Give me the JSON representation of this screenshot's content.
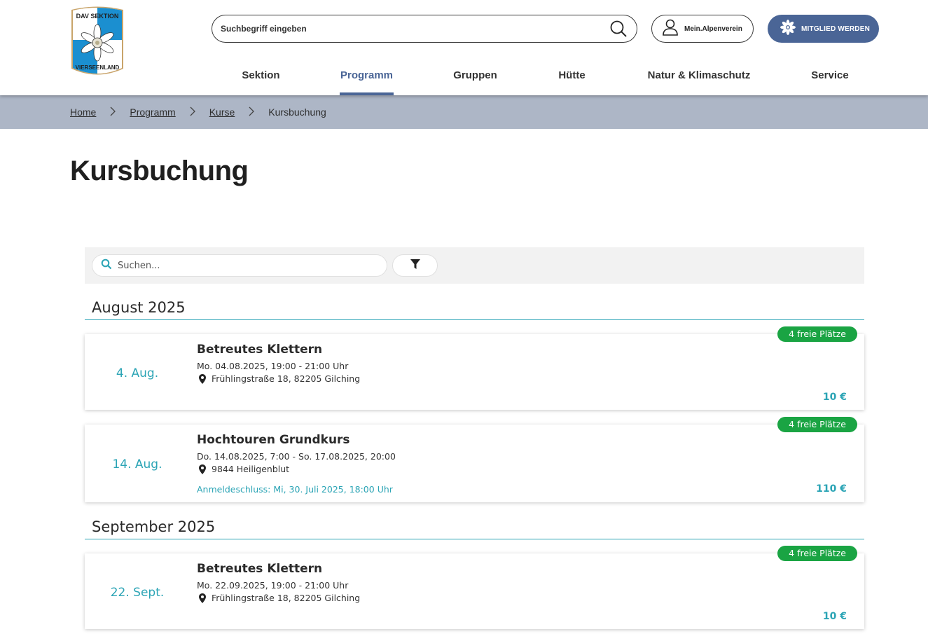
{
  "logo": {
    "top_text": "DAV SEKTION",
    "bottom_text": "VIERSEENLAND",
    "colors": {
      "blue": "#1b8fd0",
      "white": "#ffffff",
      "gold": "#c9a46a"
    },
    "icon": "edelweiss-icon"
  },
  "header": {
    "search_placeholder": "Suchbegriff eingeben",
    "login_label": "Mein.Alpenverein",
    "member_label": "MITGLIED WERDEN",
    "accent": "#4a6596"
  },
  "nav": {
    "items": [
      {
        "label": "Sektion",
        "active": false
      },
      {
        "label": "Programm",
        "active": true
      },
      {
        "label": "Gruppen",
        "active": false
      },
      {
        "label": "Hütte",
        "active": false
      },
      {
        "label": "Natur & Klimaschutz",
        "active": false
      },
      {
        "label": "Service",
        "active": false
      }
    ]
  },
  "breadcrumb": {
    "items": [
      "Home",
      "Programm",
      "Kurse"
    ],
    "current": "Kursbuchung"
  },
  "page": {
    "title": "Kursbuchung"
  },
  "filter": {
    "search_placeholder": "Suchen..."
  },
  "months": [
    {
      "label": "August 2025",
      "courses": [
        {
          "date_label": "4. Aug.",
          "title": "Betreutes Klettern",
          "when": "Mo. 04.08.2025, 19:00 - 21:00 Uhr",
          "where": "Frühlingstraße 18, 82205 Gilching",
          "deadline": "",
          "price": "10 €",
          "badge": "4 freie Plätze"
        },
        {
          "date_label": "14. Aug.",
          "title": "Hochtouren Grundkurs",
          "when": "Do. 14.08.2025, 7:00 - So. 17.08.2025, 20:00",
          "where": "9844 Heiligenblut",
          "deadline": "Anmeldeschluss: Mi, 30. Juli 2025, 18:00 Uhr",
          "price": "110 €",
          "badge": "4 freie Plätze"
        }
      ]
    },
    {
      "label": "September 2025",
      "courses": [
        {
          "date_label": "22. Sept.",
          "title": "Betreutes Klettern",
          "when": "Mo. 22.09.2025, 19:00 - 21:00 Uhr",
          "where": "Frühlingstraße 18, 82205 Gilching",
          "deadline": "",
          "price": "10 €",
          "badge": "4 freie Plätze"
        }
      ]
    }
  ],
  "colors": {
    "teal": "#2ba4b5",
    "badge_green": "#1aa443",
    "crumb_bg": "#adb6c6"
  }
}
